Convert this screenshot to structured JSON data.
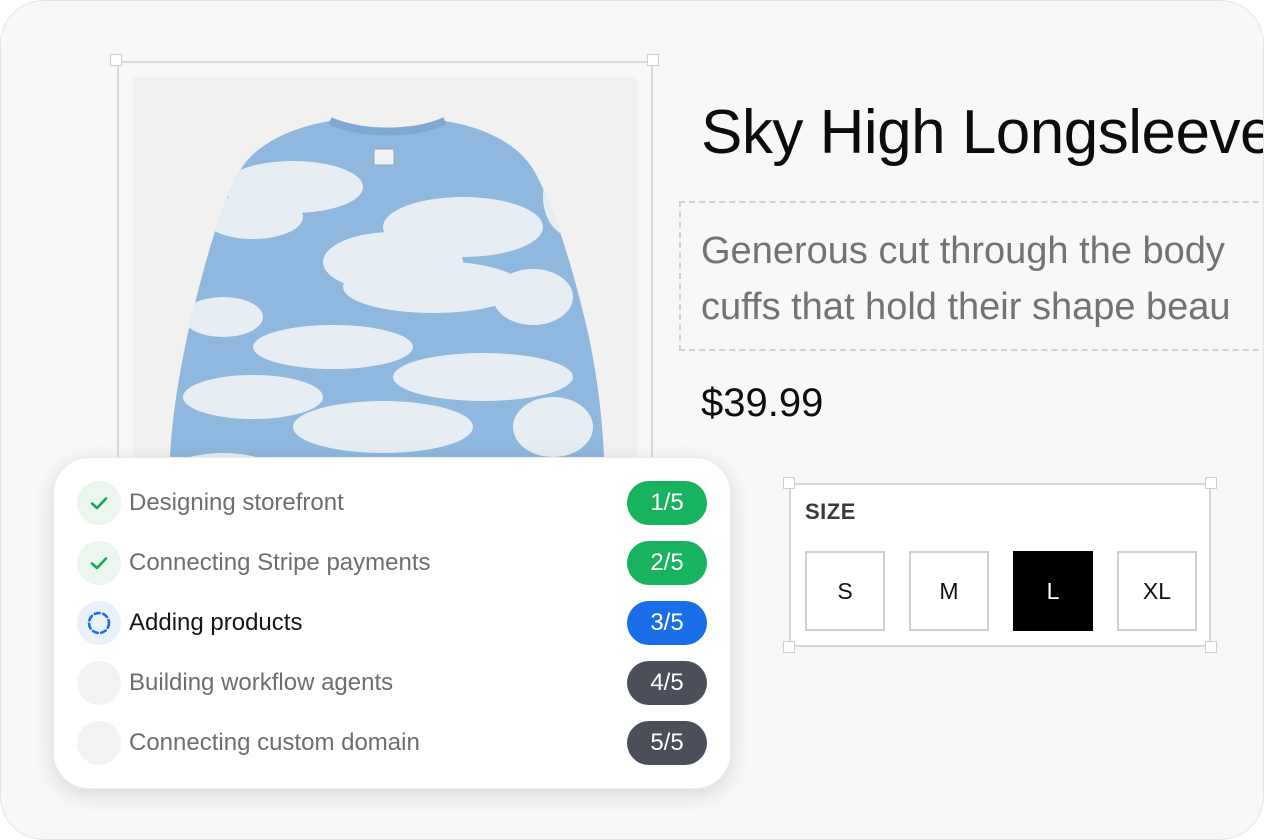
{
  "product": {
    "title": "Sky High Longsleeve",
    "description_line1": "Generous cut through the body",
    "description_line2": "cuffs that hold their shape beau",
    "price": "$39.99",
    "image_icon": "longsleeve-product-photo"
  },
  "size_selector": {
    "label": "SIZE",
    "options": [
      "S",
      "M",
      "L",
      "XL"
    ],
    "selected": "L"
  },
  "progress": {
    "steps": [
      {
        "label": "Designing storefront",
        "badge": "1/5",
        "status": "done"
      },
      {
        "label": "Connecting Stripe payments",
        "badge": "2/5",
        "status": "done"
      },
      {
        "label": "Adding products",
        "badge": "3/5",
        "status": "active"
      },
      {
        "label": "Building workflow agents",
        "badge": "4/5",
        "status": "pending"
      },
      {
        "label": "Connecting custom domain",
        "badge": "5/5",
        "status": "pending"
      }
    ]
  },
  "colors": {
    "done": "#17b35f",
    "active": "#1a6ee8",
    "pending": "#4a4f59",
    "selected_size_bg": "#000000"
  },
  "icons": {
    "done": "check-icon",
    "active": "loading-spinner-icon",
    "pending": "empty-circle-icon"
  }
}
